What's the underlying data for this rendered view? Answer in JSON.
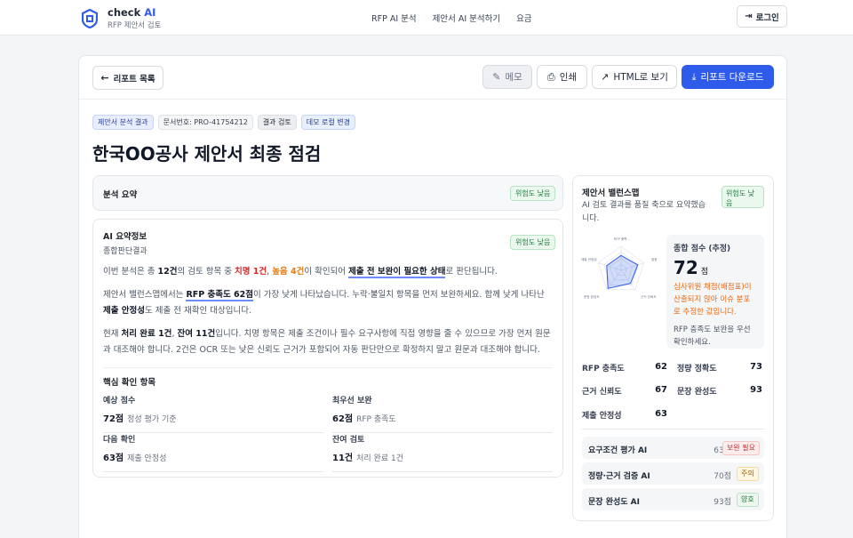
{
  "brand": {
    "name": "check ",
    "name_ai": "AI",
    "sub": "RFP 제안서 검토"
  },
  "nav": [
    "RFP AI 분석",
    "제안서 AI 분석하기",
    "요금"
  ],
  "login_label": "로그인",
  "toolbar": {
    "back": "리포트 목록",
    "memo": "메모",
    "print": "인쇄",
    "html": "HTML로 보기",
    "download": "리포트 다운로드"
  },
  "tags": [
    "제안서 분석 결과",
    "문서번호: PRO-41754212",
    "결과 검토",
    "데모 로컬 변경"
  ],
  "title": "한국OO공사 제안서 최종 점검",
  "summary": {
    "title": "분석 요약",
    "badge": "위험도 낮음"
  },
  "info": {
    "title": "AI 요약정보",
    "subtitle": "종합판단결과",
    "badge": "위험도 낮음",
    "p1": [
      "이번 분석은 총 ",
      "12건",
      "의 검토 항목 중 ",
      "치명 1건",
      ", ",
      "높음 4건",
      "이 확인되어 ",
      "제출 전 보완이 필요한 상태",
      "로 판단됩니다."
    ],
    "p2": [
      "제안서 밸런스맵에서는 ",
      "RFP 충족도 62점",
      "이 가장 낮게 나타났습니다. 누락·불일치 항목을 먼저 보완하세요. 함께 낮게 나타난 ",
      "제출 안정성",
      "도 제출 전 재확인 대상입니다."
    ],
    "p3": [
      "현재 ",
      "처리 완료 1건",
      ", ",
      "잔여 11건",
      "입니다. 치명 항목은 제출 조건이나 필수 요구사항에 직접 영향을 줄 수 있으므로 가장 먼저 원문과 대조해야 합니다. 2건은 OCR 또는 낮은 신뢰도 근거가 포함되어 자동 판단만으로 확정하지 말고 원문과 대조해야 합니다."
    ],
    "key_title": "핵심 확인 항목",
    "kv": [
      {
        "label": "예상 점수",
        "value": "72점",
        "note": "정성 평가 기준"
      },
      {
        "label": "최우선 보완",
        "value": "62점",
        "note": "RFP 충족도"
      },
      {
        "label": "다음 확인",
        "value": "63점",
        "note": "제출 안정성"
      },
      {
        "label": "잔여 검토",
        "value": "11건",
        "note": "처리 완료 1건"
      }
    ]
  },
  "balance": {
    "title": "제안서 밸런스맵",
    "desc": "AI 검토 결과를 품질 축으로 요약했습니다.",
    "badge": "위험도 낮음",
    "radar_labels": [
      "RFP 충족...",
      "정량",
      "근거 신뢰도",
      "문장 완성도",
      "제출 안정성"
    ],
    "score_label": "종합 점수 (추정)",
    "score": "72",
    "score_unit": "점",
    "warn": "심사위원 채점(배점표)이 산출되지 않아 이슈 분포로 추정한 값입니다.",
    "note": "RFP 충족도 보완을 우선 확인하세요.",
    "metrics": [
      {
        "k": "RFP 충족도",
        "v": "62"
      },
      {
        "k": "정량 정확도",
        "v": "73"
      },
      {
        "k": "근거 신뢰도",
        "v": "67"
      },
      {
        "k": "문장 완성도",
        "v": "93"
      },
      {
        "k": "제출 안정성",
        "v": "63"
      }
    ],
    "ai_rows": [
      {
        "k": "요구조건 평가 AI",
        "s": "63점",
        "chip": "보완 필요"
      },
      {
        "k": "정량·근거 검증 AI",
        "s": "70점",
        "chip": "주의"
      },
      {
        "k": "문장 완성도 AI",
        "s": "93점",
        "chip": "양호"
      }
    ]
  },
  "radar_values": [
    0.62,
    0.73,
    0.67,
    0.93,
    0.63
  ],
  "colors": {
    "accent": "#2f5bea",
    "danger": "#dc2626",
    "warning": "#ea7a12",
    "success": "#1e7a3c"
  }
}
